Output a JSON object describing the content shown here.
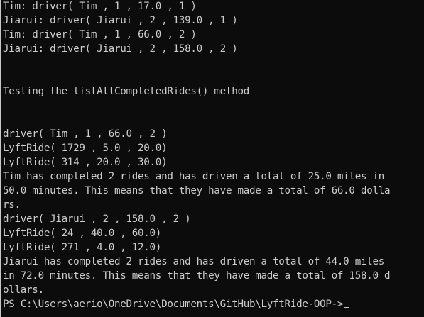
{
  "terminal": {
    "lines": [
      "Tim: driver( Tim , 1 , 17.0 , 1 )",
      "Jiarui: driver( Jiarui , 2 , 139.0 , 1 )",
      "Tim: driver( Tim , 1 , 66.0 , 2 )",
      "Jiarui: driver( Jiarui , 2 , 158.0 , 2 )",
      "",
      "",
      "Testing the listAllCompletedRides() method",
      "",
      "",
      "driver( Tim , 1 , 66.0 , 2 )",
      "LyftRide( 1729 , 5.0 , 20.0)",
      "LyftRide( 314 , 20.0 , 30.0)",
      "Tim has completed 2 rides and has driven a total of 25.0 miles in",
      "50.0 minutes. This means that they have made a total of 66.0 dolla",
      "rs.",
      "driver( Jiarui , 2 , 158.0 , 2 )",
      "LyftRide( 24 , 40.0 , 60.0)",
      "LyftRide( 271 , 4.0 , 12.0)",
      "Jiarui has completed 2 rides and has driven a total of 44.0 miles",
      "in 72.0 minutes. This means that they have made a total of 158.0 d",
      "ollars."
    ],
    "prompt": "PS C:\\Users\\aerio\\OneDrive\\Documents\\GitHub\\LyftRide-OOP->"
  },
  "colors": {
    "background": "#0c0c0c",
    "text": "#cccccc"
  }
}
